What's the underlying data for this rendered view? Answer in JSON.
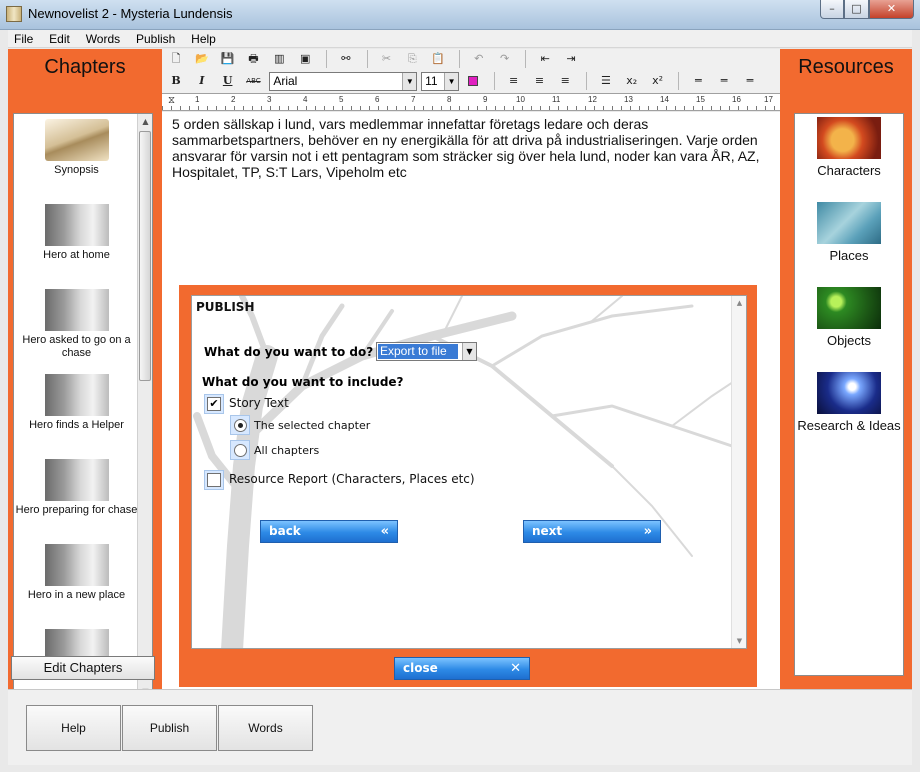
{
  "window": {
    "title": "Newnovelist 2 - Mysteria Lundensis",
    "min": "–",
    "max": "□",
    "close": "✕"
  },
  "menu": [
    "File",
    "Edit",
    "Words",
    "Publish",
    "Help"
  ],
  "chapters_panel": {
    "title": "Chapters",
    "items": [
      {
        "label": "Synopsis",
        "icon": "open-book-icon"
      },
      {
        "label": "Hero at home",
        "icon": "door-icon"
      },
      {
        "label": "Hero asked to go on a chase",
        "icon": "door-icon"
      },
      {
        "label": "Hero finds a Helper",
        "icon": "door-icon"
      },
      {
        "label": "Hero preparing for chase",
        "icon": "door-icon"
      },
      {
        "label": "Hero in a new place",
        "icon": "door-icon"
      }
    ],
    "edit_button": "Edit Chapters"
  },
  "resources_panel": {
    "title": "Resources",
    "items": [
      {
        "label": "Characters",
        "icon": "characters-icon"
      },
      {
        "label": "Places",
        "icon": "places-icon"
      },
      {
        "label": "Objects",
        "icon": "objects-icon"
      },
      {
        "label": "Research & Ideas",
        "icon": "research-icon"
      }
    ]
  },
  "toolbar": {
    "font": "Arial",
    "size": "11",
    "bold": "B",
    "italic": "I",
    "underline": "U",
    "spell": "ABC"
  },
  "ruler_numbers": [
    "1",
    "2",
    "3",
    "4",
    "5",
    "6",
    "7",
    "8",
    "9",
    "10",
    "11",
    "12",
    "13",
    "14",
    "15",
    "16",
    "17"
  ],
  "editor": {
    "text": "5 orden sällskap i lund, vars medlemmar innefattar företags ledare och deras sammarbetspartners, behöver en ny energikälla för att driva på industrialiseringen. Varje orden ansvarar för varsin not i ett pentagram som sträcker sig över hela lund, noder kan vara ÅR, AZ, Hospitalet, TP, S:T Lars, Vipeholm etc"
  },
  "publish": {
    "title": "PUBLISH",
    "question1": "What do you want to do?",
    "action_value": "Export to file",
    "question2": "What do you want to include?",
    "story_text": "Story Text",
    "selected_chapter": "The selected chapter",
    "all_chapters": "All chapters",
    "resource_report": "Resource Report (Characters, Places etc)",
    "back": "back",
    "next": "next",
    "close": "close"
  },
  "bottom_buttons": [
    "Help",
    "Publish",
    "Words"
  ],
  "colors": {
    "accent": "#f26a2f",
    "button_blue": "#2d8ae6"
  }
}
